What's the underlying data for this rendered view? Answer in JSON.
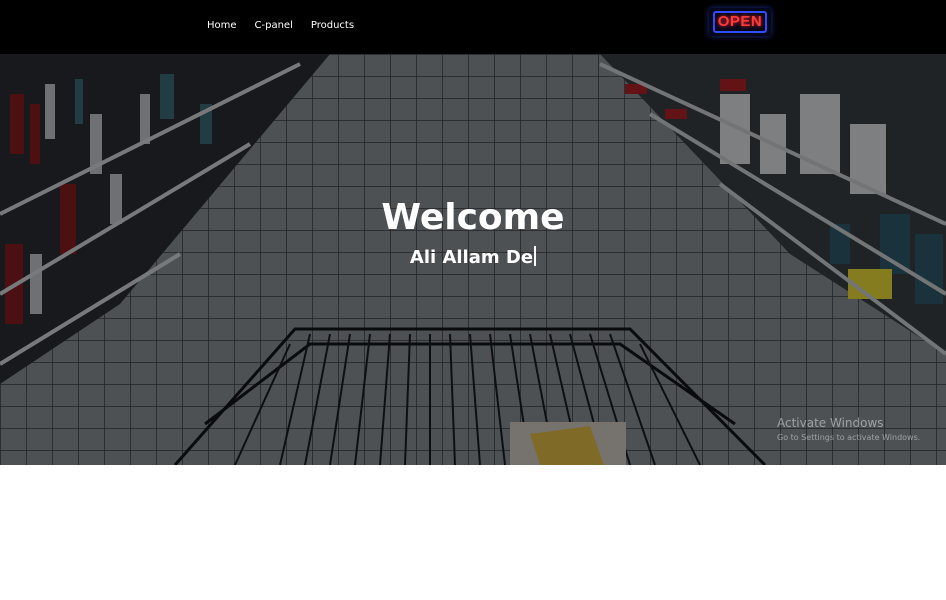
{
  "nav": {
    "links": [
      "Home",
      "C-panel",
      "Products"
    ],
    "sign_text": "OPEN"
  },
  "hero": {
    "title": "Welcome",
    "subtitle": "Ali Allam De"
  },
  "watermark": {
    "title": "Activate Windows",
    "subtitle": "Go to Settings to activate Windows."
  },
  "colors": {
    "navbar": "#000000",
    "hero_overlay": "rgba(0,0,0,0.45)",
    "sign_red": "#ff3a3a",
    "sign_blue": "#2f4dff"
  }
}
